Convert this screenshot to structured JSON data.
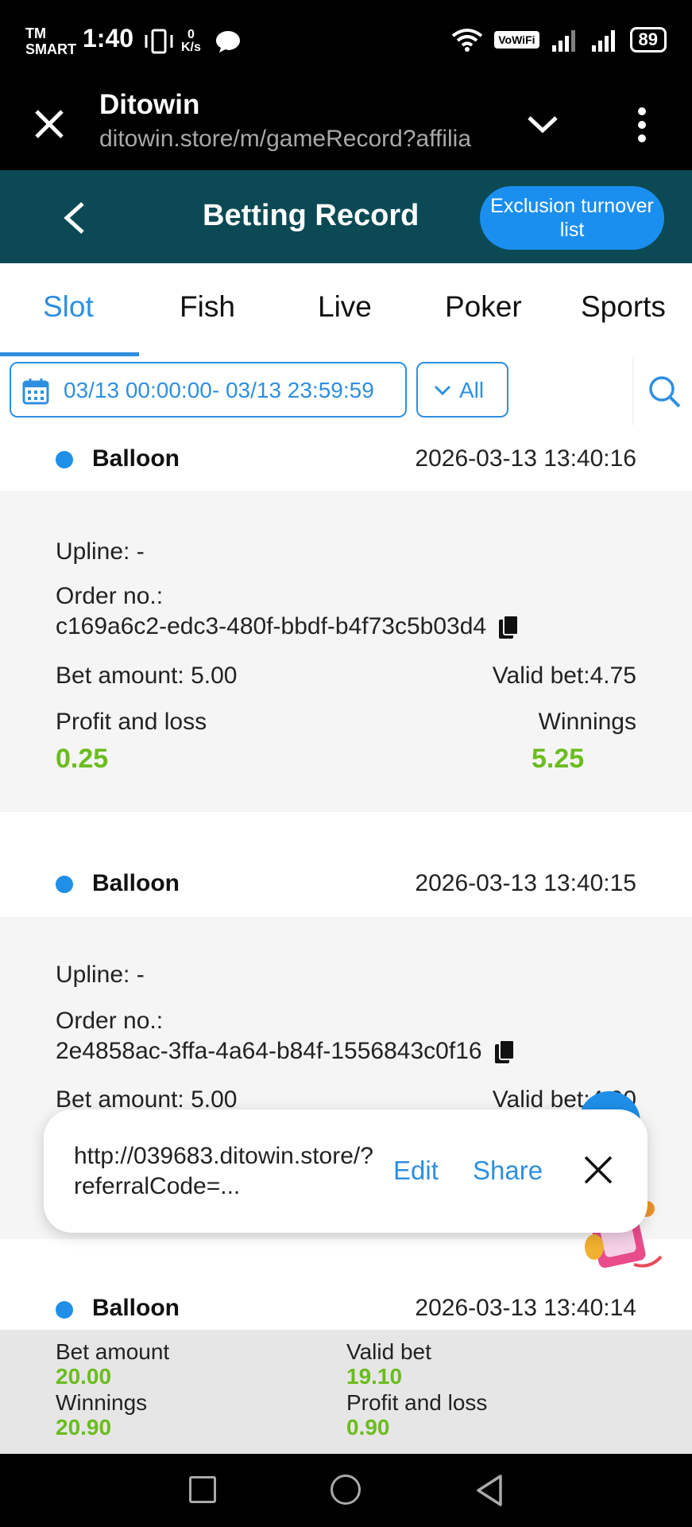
{
  "status_bar": {
    "carrier_top": "TM",
    "carrier_bottom": "SMART",
    "time": "1:40",
    "speed_value": "0",
    "speed_unit": "K/s",
    "vowifi": "VoWiFi",
    "battery": "89"
  },
  "browser": {
    "title": "Ditowin",
    "url": "ditowin.store/m/gameRecord?affilia"
  },
  "header": {
    "title": "Betting Record",
    "exclusion_button": "Exclusion turnover list",
    "color": "#0b4a55"
  },
  "tabs": [
    {
      "label": "Slot",
      "active": true
    },
    {
      "label": "Fish",
      "active": false
    },
    {
      "label": "Live",
      "active": false
    },
    {
      "label": "Poker",
      "active": false
    },
    {
      "label": "Sports",
      "active": false
    }
  ],
  "filter": {
    "date_range": "03/13 00:00:00- 03/13 23:59:59",
    "type": "All"
  },
  "records": [
    {
      "game": "Balloon",
      "time": "2026-03-13 13:40:16",
      "upline": "Upline: -",
      "order_label": "Order no.:",
      "order_no": "c169a6c2-edc3-480f-bbdf-b4f73c5b03d4",
      "bet_amount": "Bet amount: 5.00",
      "valid_bet": "Valid bet:4.75",
      "profit_label": "Profit and loss",
      "profit": "0.25",
      "winnings_label": "Winnings",
      "winnings": "5.25"
    },
    {
      "game": "Balloon",
      "time": "2026-03-13 13:40:15",
      "upline": "Upline: -",
      "order_label": "Order no.:",
      "order_no": "2e4858ac-3ffa-4a64-b84f-1556843c0f16",
      "bet_amount": "Bet amount: 5.00",
      "valid_bet": "Valid bet:4.90"
    },
    {
      "game": "Balloon",
      "time": "2026-03-13 13:40:14"
    }
  ],
  "popup": {
    "url": "http://039683.ditowin.store/?referralCode=...",
    "edit": "Edit",
    "share": "Share"
  },
  "summary": {
    "bet_amount_label": "Bet amount",
    "bet_amount": "20.00",
    "valid_bet_label": "Valid bet",
    "valid_bet": "19.10",
    "winnings_label": "Winnings",
    "winnings": "20.90",
    "profit_label": "Profit and loss",
    "profit": "0.90"
  },
  "colors": {
    "accent": "#2e8fe0",
    "positive": "#6bbc1e"
  }
}
